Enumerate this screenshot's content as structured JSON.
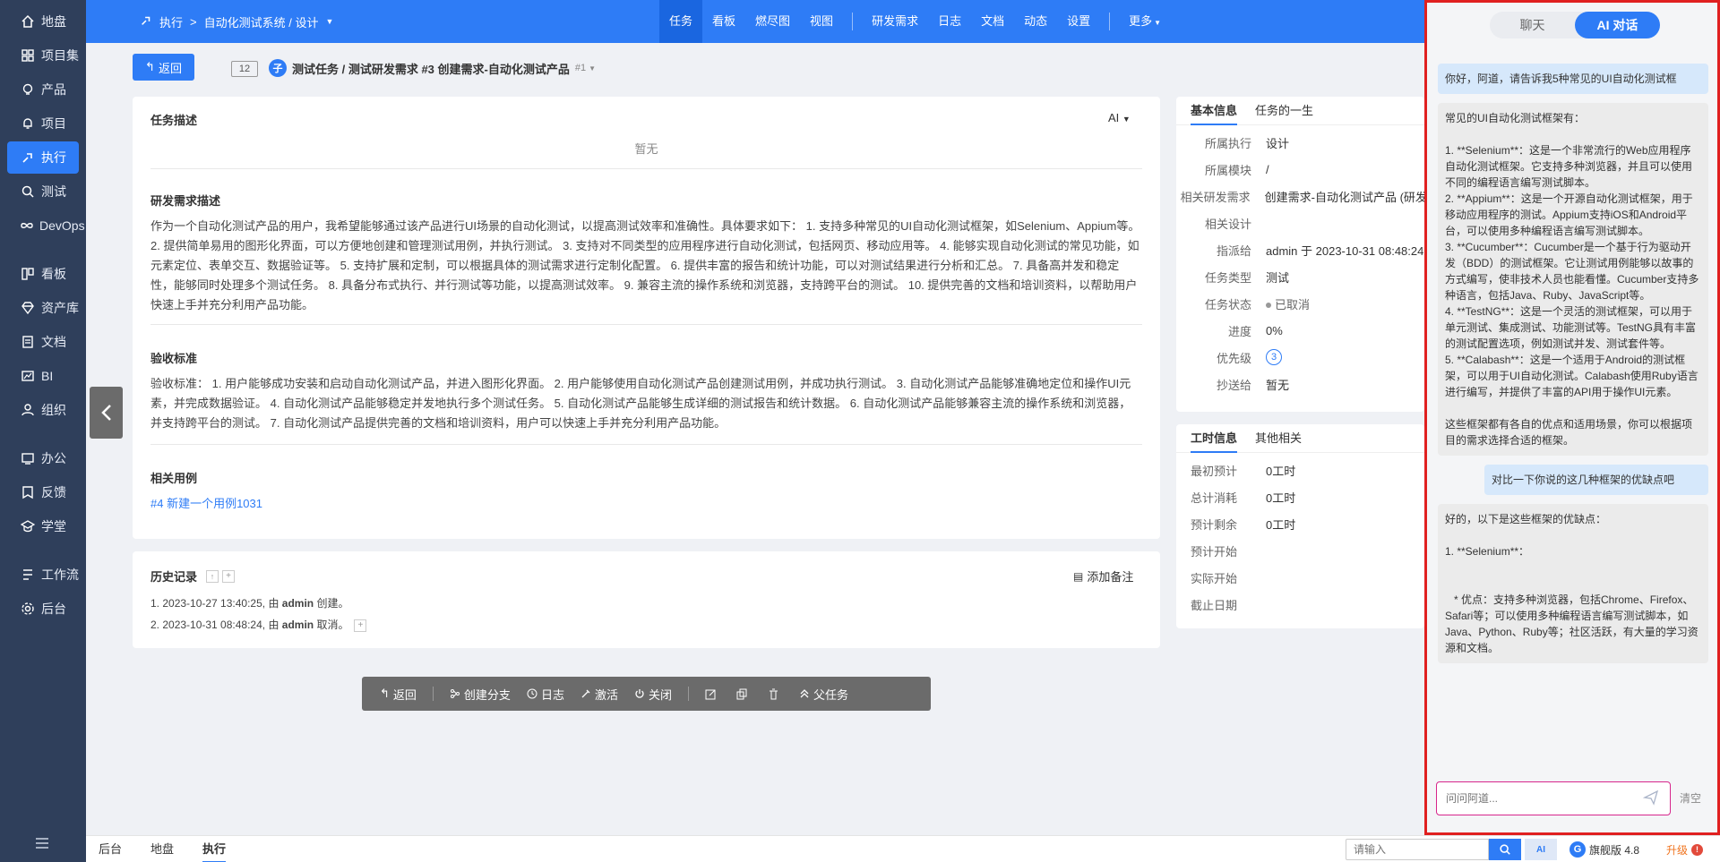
{
  "sidebar": {
    "items": [
      {
        "label": "地盘",
        "icon": "home-icon"
      },
      {
        "label": "项目集",
        "icon": "grid-icon"
      },
      {
        "label": "产品",
        "icon": "lightbulb-icon"
      },
      {
        "label": "项目",
        "icon": "bell-icon"
      },
      {
        "label": "执行",
        "icon": "run-icon",
        "active": true
      },
      {
        "label": "测试",
        "icon": "search-icon"
      },
      {
        "label": "DevOps",
        "icon": "infinity-icon"
      },
      {
        "label": "看板",
        "icon": "board-icon"
      },
      {
        "label": "资产库",
        "icon": "diamond-icon"
      },
      {
        "label": "文档",
        "icon": "document-icon"
      },
      {
        "label": "BI",
        "icon": "chart-icon"
      },
      {
        "label": "组织",
        "icon": "users-icon"
      },
      {
        "label": "办公",
        "icon": "office-icon"
      },
      {
        "label": "反馈",
        "icon": "feedback-icon"
      },
      {
        "label": "学堂",
        "icon": "school-icon"
      },
      {
        "label": "工作流",
        "icon": "workflow-icon"
      },
      {
        "label": "后台",
        "icon": "gear-icon"
      }
    ]
  },
  "topbar": {
    "crumb_exec": "执行",
    "crumb_sep": ">",
    "crumb_path": "自动化测试系统 / 设计",
    "nav": [
      "任务",
      "看板",
      "燃尽图",
      "视图",
      "研发需求",
      "日志",
      "文档",
      "动态",
      "设置",
      "更多"
    ]
  },
  "header": {
    "back": "返回",
    "id": "12",
    "badge": "子",
    "title": "测试任务 / 测试研发需求 #3 创建需求-自动化测试产品",
    "version": "#1"
  },
  "main": {
    "task_desc_title": "任务描述",
    "ai_label": "AI",
    "task_desc_empty": "暂无",
    "req_title": "研发需求描述",
    "req_text": "作为一个自动化测试产品的用户，我希望能够通过该产品进行UI场景的自动化测试，以提高测试效率和准确性。具体要求如下： 1. 支持多种常见的UI自动化测试框架，如Selenium、Appium等。 2. 提供简单易用的图形化界面，可以方便地创建和管理测试用例，并执行测试。 3. 支持对不同类型的应用程序进行自动化测试，包括网页、移动应用等。 4. 能够实现自动化测试的常见功能，如元素定位、表单交互、数据验证等。 5. 支持扩展和定制，可以根据具体的测试需求进行定制化配置。 6. 提供丰富的报告和统计功能，可以对测试结果进行分析和汇总。 7. 具备高并发和稳定性，能够同时处理多个测试任务。 8. 具备分布式执行、并行测试等功能，以提高测试效率。 9. 兼容主流的操作系统和浏览器，支持跨平台的测试。 10. 提供完善的文档和培训资料，以帮助用户快速上手并充分利用产品功能。",
    "accept_title": "验收标准",
    "accept_text": "验收标准： 1. 用户能够成功安装和启动自动化测试产品，并进入图形化界面。 2. 用户能够使用自动化测试产品创建测试用例，并成功执行测试。 3. 自动化测试产品能够准确地定位和操作UI元素，并完成数据验证。 4. 自动化测试产品能够稳定并发地执行多个测试任务。 5. 自动化测试产品能够生成详细的测试报告和统计数据。 6. 自动化测试产品能够兼容主流的操作系统和浏览器，并支持跨平台的测试。 7. 自动化测试产品提供完善的文档和培训资料，用户可以快速上手并充分利用产品功能。",
    "cases_title": "相关用例",
    "case_link": "#4 新建一个用例1031"
  },
  "history": {
    "title": "历史记录",
    "add_note": "添加备注",
    "entries": [
      {
        "prefix": "1. 2023-10-27 13:40:25, 由 ",
        "user": "admin",
        "action": " 创建。"
      },
      {
        "prefix": "2. 2023-10-31 08:48:24, 由 ",
        "user": "admin",
        "action": " 取消。"
      }
    ]
  },
  "toolbar": {
    "back": "返回",
    "branch": "创建分支",
    "log": "日志",
    "activate": "激活",
    "close": "关闭",
    "parent": "父任务"
  },
  "info": {
    "tab_basic": "基本信息",
    "tab_life": "任务的一生",
    "rows": [
      {
        "k": "所属执行",
        "v": "设计",
        "link": true
      },
      {
        "k": "所属模块",
        "v": "/"
      },
      {
        "k": "相关研发需求",
        "v": "创建需求-自动化测试产品 (研发",
        "link": true
      },
      {
        "k": "相关设计",
        "v": ""
      },
      {
        "k": "指派给",
        "v": "admin 于 2023-10-31 08:48:24"
      },
      {
        "k": "任务类型",
        "v": "测试"
      },
      {
        "k": "任务状态",
        "v": "已取消"
      },
      {
        "k": "进度",
        "v": "0%"
      },
      {
        "k": "优先级",
        "v": "3"
      },
      {
        "k": "抄送给",
        "v": "暂无"
      }
    ]
  },
  "time": {
    "tab_time": "工时信息",
    "tab_other": "其他相关",
    "rows": [
      {
        "k": "最初预计",
        "v": "0工时"
      },
      {
        "k": "总计消耗",
        "v": "0工时"
      },
      {
        "k": "预计剩余",
        "v": "0工时"
      },
      {
        "k": "预计开始",
        "v": ""
      },
      {
        "k": "实际开始",
        "v": ""
      },
      {
        "k": "截止日期",
        "v": ""
      }
    ]
  },
  "chat": {
    "tab_chat": "聊天",
    "tab_ai": "AI 对话",
    "messages": [
      {
        "role": "user",
        "text": "你好，阿道，请告诉我5种常见的UI自动化测试框"
      },
      {
        "role": "ai",
        "text": "常见的UI自动化测试框架有：\n\n1. **Selenium**：这是一个非常流行的Web应用程序自动化测试框架。它支持多种浏览器，并且可以使用不同的编程语言编写测试脚本。\n2. **Appium**：这是一个开源自动化测试框架，用于移动应用程序的测试。Appium支持iOS和Android平台，可以使用多种编程语言编写测试脚本。\n3. **Cucumber**：Cucumber是一个基于行为驱动开发（BDD）的测试框架。它让测试用例能够以故事的方式编写，使非技术人员也能看懂。Cucumber支持多种语言，包括Java、Ruby、JavaScript等。\n4. **TestNG**：这是一个灵活的测试框架，可以用于单元测试、集成测试、功能测试等。TestNG具有丰富的测试配置选项，例如测试并发、测试套件等。\n5. **Calabash**：这是一个适用于Android的测试框架，可以用于UI自动化测试。Calabash使用Ruby语言进行编写，并提供了丰富的API用于操作UI元素。\n\n这些框架都有各自的优点和适用场景，你可以根据项目的需求选择合适的框架。"
      },
      {
        "role": "user-right",
        "text": "对比一下你说的这几种框架的优缺点吧"
      },
      {
        "role": "ai",
        "text": "好的，以下是这些框架的优缺点：\n\n1. **Selenium**：\n\n\n   * 优点：支持多种浏览器，包括Chrome、Firefox、Safari等；可以使用多种编程语言编写测试脚本，如Java、Python、Ruby等；社区活跃，有大量的学习资源和文档。"
      }
    ],
    "input_placeholder": "问问阿道...",
    "clear": "清空"
  },
  "bottombar": {
    "items": [
      "后台",
      "地盘",
      "执行"
    ],
    "search_placeholder": "请输入",
    "ai_badge": "AI",
    "edition": "旗舰版 4.8",
    "upgrade": "升级"
  },
  "colors": {
    "primary": "#2e7cf6",
    "sidebar": "#2f3f5b",
    "chat_border": "#e02020"
  }
}
